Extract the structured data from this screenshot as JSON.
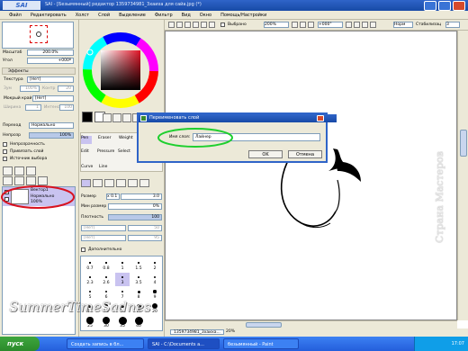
{
  "window": {
    "logo_text": "SAI",
    "title": "SАI - [Безымянный] редактор 1359734981_3хаиха для сайа.jpg (*)"
  },
  "menu": {
    "items": [
      "Файл",
      "Редактировать",
      "Холст",
      "Слой",
      "Выделение",
      "Фильтр",
      "Вид",
      "Окно",
      "Помощь/Настройки"
    ]
  },
  "toolbar": {
    "selection_label": "Выбрано",
    "zoom_value": "200%",
    "angle_value": "+000°",
    "normal_label": "Норм",
    "stabilizer_label": "Стабилизац",
    "stabilizer_value": "3"
  },
  "navigator": {
    "scale_label": "Масштаб",
    "scale_value": "200.0%",
    "angle_label": "Угол",
    "angle_value": "+000º"
  },
  "effects": {
    "header": "Эффекты",
    "texture_label": "Текстура",
    "texture_value": "[Нет]",
    "scale_label": "Зум",
    "scale_value": "100%",
    "contrast_label": "Контр",
    "contrast_value": "20",
    "wet_edge_label": "Мокрый край",
    "wet_edge_value": "[Нет]",
    "width_label": "Ширина",
    "width_value": "1",
    "intensity_label": "Интенс",
    "intensity_value": "100"
  },
  "layer_props": {
    "mode_label": "Переход",
    "mode_value": "Нормально",
    "opacity_label": "Непрозр",
    "opacity_value": "100%",
    "opacity_fraction": 1.0,
    "protect_label": "Непрозрачность",
    "clip_label": "Привязать слой",
    "source_label": "Источник выбора"
  },
  "layers": [
    {
      "name": "Вектор1",
      "mode": "Нормально",
      "opacity": "100%",
      "selected": true
    }
  ],
  "tools": {
    "names": [
      "Pen",
      "Eraser",
      "Weight",
      "Color",
      "Edit",
      "Pressure",
      "Select",
      "Curve",
      "Line"
    ]
  },
  "brush": {
    "size_label": "Размер",
    "size_mult": "x 0.1",
    "size_value": "3.0",
    "min_size_label": "Мин размер",
    "min_size_value": "0%",
    "density_label": "Плотность",
    "density_value": "100",
    "shape_label": "[Нет]",
    "shape_value": "50",
    "texture_label": "[Нет]",
    "texture_value": "95",
    "advanced_label": "Дополнительно",
    "size_presets": [
      "0.7",
      "0.8",
      "1",
      "1.5",
      "2",
      "2.3",
      "2.6",
      "3",
      "3.5",
      "4",
      "5",
      "6",
      "7",
      "8",
      "9",
      "10",
      "12",
      "14",
      "16",
      "20",
      "25",
      "30",
      "35",
      "40"
    ]
  },
  "dialog": {
    "title": "Переименовать слой",
    "name_label": "Имя слоя:",
    "name_value": "Лайнер",
    "ok_label": "OK",
    "cancel_label": "Отмена"
  },
  "status": {
    "file": "1359734981_3хаиха...",
    "zoom": "20%"
  },
  "taskbar": {
    "start_label": "пуск",
    "tasks": [
      "Создать запись в бл...",
      "SAI - C:\\Documents a...",
      "безымянный - Paint"
    ],
    "clock": "17:07"
  },
  "watermarks": {
    "left": "SummerTimeSadnes",
    "right": "Страна Мастеров"
  },
  "colors": {
    "accent": "#2f64c8",
    "highlight": "#1ecf2e",
    "annotation_red": "#d8121f",
    "layer_selected": "#c9c3f0",
    "taskbar": "#245edb"
  }
}
